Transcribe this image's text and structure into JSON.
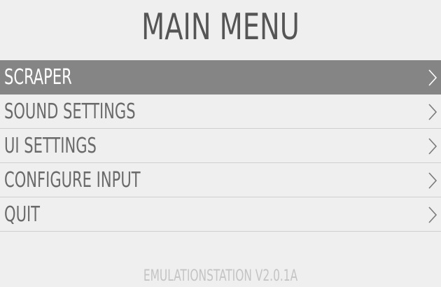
{
  "title": "MAIN MENU",
  "menu": {
    "items": [
      {
        "label": "SCRAPER",
        "selected": true,
        "icon": "chevron-right-icon"
      },
      {
        "label": "SOUND SETTINGS",
        "selected": false,
        "icon": "chevron-right-icon"
      },
      {
        "label": "UI SETTINGS",
        "selected": false,
        "icon": "chevron-right-icon"
      },
      {
        "label": "CONFIGURE INPUT",
        "selected": false,
        "icon": "chevron-right-icon"
      },
      {
        "label": "QUIT",
        "selected": false,
        "icon": "chevron-right-icon"
      }
    ]
  },
  "footer": {
    "version": "EMULATIONSTATION V2.0.1A"
  },
  "colors": {
    "background": "#efefef",
    "selected_row": "#858585",
    "title_text": "#555555",
    "item_text": "#6a6a6a",
    "footer_text": "#c4c4c4"
  }
}
